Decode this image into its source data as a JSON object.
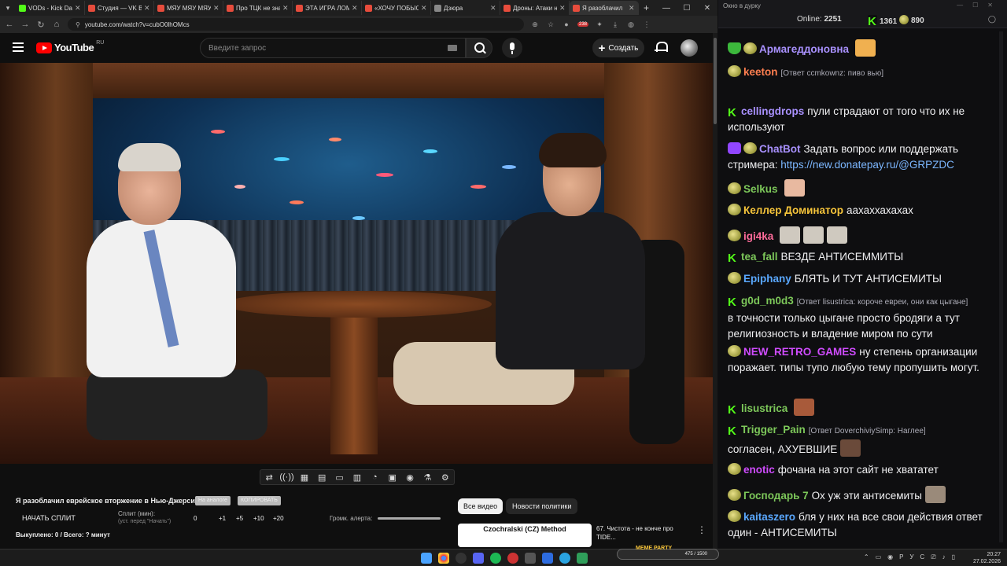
{
  "browser": {
    "tabs": [
      {
        "title": "VODs - Kick Dashb",
        "color": "#53fc18"
      },
      {
        "title": "Студия — VK Виде",
        "color": "#e74c3c"
      },
      {
        "title": "МЯУ МЯУ МЯУ М",
        "color": "#e74c3c"
      },
      {
        "title": "Про ТЦК не знаю",
        "color": "#e74c3c"
      },
      {
        "title": "ЭТА ИГРА ЛОМАЕ",
        "color": "#e74c3c"
      },
      {
        "title": "«ХОЧУ ПОБЫСТРЕ",
        "color": "#e74c3c"
      },
      {
        "title": "Дзюра",
        "color": "#888888"
      },
      {
        "title": "Дроны: Атаки на Т",
        "color": "#e74c3c"
      },
      {
        "title": "Я разоблачил",
        "color": "#e74c3c"
      }
    ],
    "url": "youtube.com/watch?v=cubO0lhOMcs",
    "ext_badge": "238"
  },
  "youtube": {
    "logo_text": "YouTube",
    "region": "RU",
    "search_placeholder": "Введите запрос",
    "create_label": "Создать"
  },
  "video_tools": [
    "⇄",
    "((·))",
    "▦",
    "▤",
    "▭",
    "▥",
    "◔",
    "▣",
    "◉",
    "⚗",
    "⚙"
  ],
  "below_video": {
    "title": "Я разоблачил еврейское вторжение в Нью-Джерси...",
    "chip1": "На аналоге",
    "chip2": "КОПИРОВАТЬ",
    "split_label": "НАЧАТЬ СПЛИТ",
    "split_min_label": "Сплит (мин):",
    "split_sub": "(уст. перед \"Начать\")",
    "split_numbers": [
      "0",
      "+1",
      "+5",
      "+10",
      "+20"
    ],
    "alert_label": "Громк. алерта:",
    "bought": "Выкуплено: 0 / Всего: ? минут",
    "filter_all": "Все видео",
    "filter_news": "Новости политики",
    "related_thumb_text": "Czochralski (CZ) Method",
    "related_title": "67. Чистота - не конче про TIDE..."
  },
  "chat": {
    "window_title": "Окно в дурку",
    "online_label": "Online:",
    "online_value": "2251",
    "kick_count": "1361",
    "points_count": "890",
    "messages": [
      {
        "badges": [
          "shield",
          "sub"
        ],
        "user": "Армагеддоновна",
        "color": "#a991ff",
        "reply": "",
        "text": "",
        "emote": "#f0b050"
      },
      {
        "badges": [
          "sub"
        ],
        "user": "keeton",
        "color": "#ff7f50",
        "reply": "[Ответ ccmkownz: пиво вью]",
        "text": "",
        "emote": ""
      },
      {
        "badges": [
          "kk"
        ],
        "user": "cellingdrops",
        "color": "#a991ff",
        "reply": "",
        "text": "пули страдают от того что их не используют",
        "emote": ""
      },
      {
        "badges": [
          "bot",
          "sub"
        ],
        "user": "ChatBot",
        "color": "#a991ff",
        "reply": "",
        "text": "Задать вопрос или поддержать стримера: ",
        "link": "https://new.donatepay.ru/@GRPZDC",
        "emote": ""
      },
      {
        "badges": [
          "sub"
        ],
        "user": "Selkus",
        "color": "#7dc85a",
        "reply": "",
        "text": "",
        "emote": "#e8b9a0"
      },
      {
        "badges": [
          "sub"
        ],
        "user": "Келлер Доминатор",
        "color": "#f6c43a",
        "reply": "",
        "text": "аахаххахахах",
        "emote": ""
      },
      {
        "badges": [
          "sub"
        ],
        "user": "igi4ka",
        "color": "#ff6b9a",
        "reply": "",
        "text": "",
        "emote": "#cfc9bf"
      },
      {
        "badges": [
          "kk"
        ],
        "user": "tea_fall",
        "color": "#7dc85a",
        "reply": "",
        "text": "ВЕЗДЕ АНТИСЕММИТЫ",
        "emote": ""
      },
      {
        "badges": [
          "sub"
        ],
        "user": "Epiphany",
        "color": "#5aa8ff",
        "reply": "",
        "text": "БЛЯТЬ И ТУТ АНТИСЕМИТЫ",
        "emote": ""
      },
      {
        "badges": [
          "kk"
        ],
        "user": "g0d_m0d3",
        "color": "#7dc85a",
        "reply": "[Ответ lisustrica: короче евреи, они как цыгане]",
        "text": "в точности только цыгане просто бродяги а тут религиозность и владение миром по сути",
        "emote": ""
      },
      {
        "badges": [
          "sub"
        ],
        "user": "NEW_RETRO_GAMES",
        "color": "#d04cff",
        "reply": "",
        "text": "ну степень организации поражает. типы тупо любую тему пропушить могут.",
        "emote": ""
      },
      {
        "badges": [
          "kk"
        ],
        "user": "lisustrica",
        "color": "#7dc85a",
        "reply": "",
        "text": "",
        "emote": "#a85a3a"
      },
      {
        "badges": [
          "kk"
        ],
        "user": "Trigger_Pain",
        "color": "#7dc85a",
        "reply": "[Ответ DoverchiviySimp: Наглее]",
        "text": "согласен, АХУЕВШИЕ",
        "emote": "#6a4a3a"
      },
      {
        "badges": [
          "sub"
        ],
        "user": "enotic",
        "color": "#d04cff",
        "reply": "",
        "text": "фочана на этот сайт не хвататет",
        "emote": ""
      },
      {
        "badges": [
          "sub"
        ],
        "user": "Господарь 7",
        "color": "#7dc85a",
        "reply": "",
        "text": "Ох уж эти антисемиты",
        "emote": "#9a8a7a"
      },
      {
        "badges": [
          "sub"
        ],
        "user": "kaitaszero",
        "color": "#5aa8ff",
        "reply": "",
        "text": "бля у них на все свои действия ответ один - АНТИСЕМИТЫ",
        "emote": ""
      }
    ]
  },
  "taskbar": {
    "lang": "РУС",
    "time": "20:27",
    "date": "27.02.2026",
    "meme_party": "MEME PARTY",
    "meme_progress": "475 / 1500"
  }
}
